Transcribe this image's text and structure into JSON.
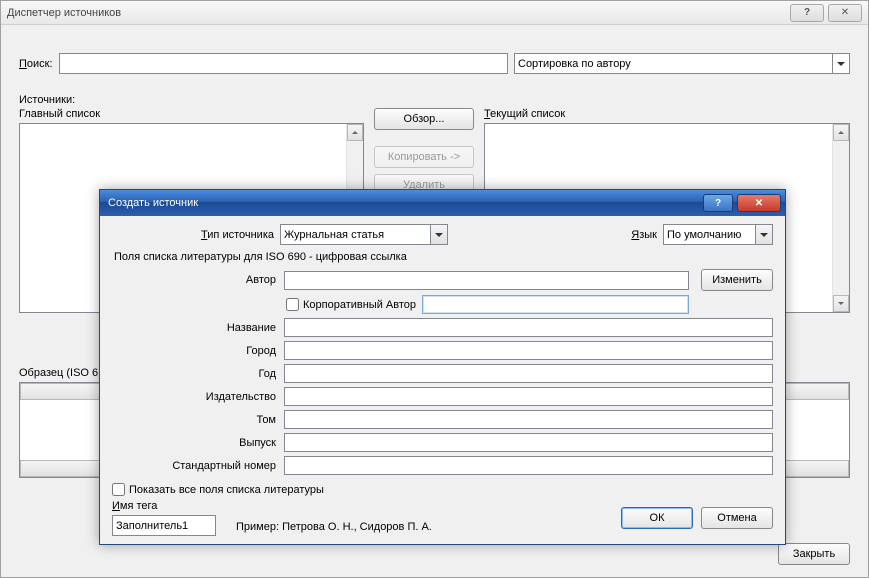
{
  "outer": {
    "title": "Диспетчер источников",
    "search_label_pre": "П",
    "search_label_rest": "оиск:",
    "sort_value": "Сортировка по автору",
    "sources_label": "Источники:",
    "master_list_label": "Главный список",
    "current_list_pre": "Т",
    "current_list_rest": "екущий список",
    "browse_btn": "Обзор...",
    "copy_btn": "Копировать ->",
    "delete_btn": "Удалить",
    "preview_label": "Образец (ISO 6",
    "close_btn": "Закрыть"
  },
  "inner": {
    "title": "Создать источник",
    "type_label_pre": "Т",
    "type_label_rest": "ип источника",
    "type_value": "Журнальная статья",
    "lang_label_pre": "Я",
    "lang_label_rest": "зык",
    "lang_value": "По умолчанию",
    "fields_title": "Поля списка литературы для ISO 690 - цифровая ссылка",
    "author_label": "Автор",
    "edit_btn": "Изменить",
    "corp_author_label": "Корпоративный Автор",
    "name_label": "Название",
    "city_label": "Город",
    "year_label": "Год",
    "publisher_label": "Издательство",
    "volume_label": "Том",
    "issue_label": "Выпуск",
    "std_number_label": "Стандартный номер",
    "show_all_label": "Показать все поля списка литературы",
    "tag_name_label_pre": "И",
    "tag_name_label_rest": "мя тега",
    "tag_name_value": "Заполнитель1",
    "example_text": "Пример: Петрова О. Н., Сидоров П. А.",
    "ok_btn": "ОК",
    "cancel_btn": "Отмена"
  }
}
